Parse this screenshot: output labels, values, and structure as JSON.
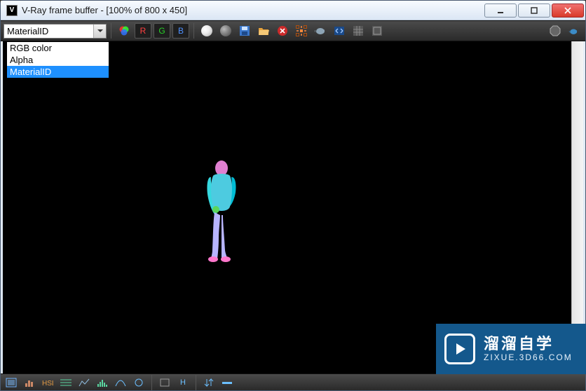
{
  "window": {
    "title": "V-Ray frame buffer - [100% of 800 x 450]"
  },
  "toolbar": {
    "channel_select": {
      "value": "MaterialID",
      "options": [
        "RGB color",
        "Alpha",
        "MaterialID"
      ],
      "highlighted_index": 2
    },
    "r_label": "R",
    "g_label": "G",
    "b_label": "B",
    "icons": {
      "rgb_circles": "rgb-circles-icon",
      "white_sphere": "white-sphere-icon",
      "grey_sphere": "grey-sphere-icon",
      "save": "save-icon",
      "folder": "folder-icon",
      "stop": "stop-icon",
      "region": "region-icon",
      "teapot1": "teapot-icon",
      "arrows": "arrows-icon",
      "grid": "grid-icon",
      "grid2": "grid2-icon",
      "stop2": "stop-octagon-icon",
      "teapot2": "teapot2-icon"
    }
  },
  "statusbar": {
    "icons": [
      "sb1",
      "sb2",
      "sb3",
      "sb4",
      "sb5",
      "sb6",
      "sb7",
      "sb8",
      "sb9",
      "sb10",
      "h",
      "sb11",
      "sb12"
    ]
  },
  "watermark": {
    "line1": "溜溜自学",
    "line2": "ZIXUE.3D66.COM"
  }
}
